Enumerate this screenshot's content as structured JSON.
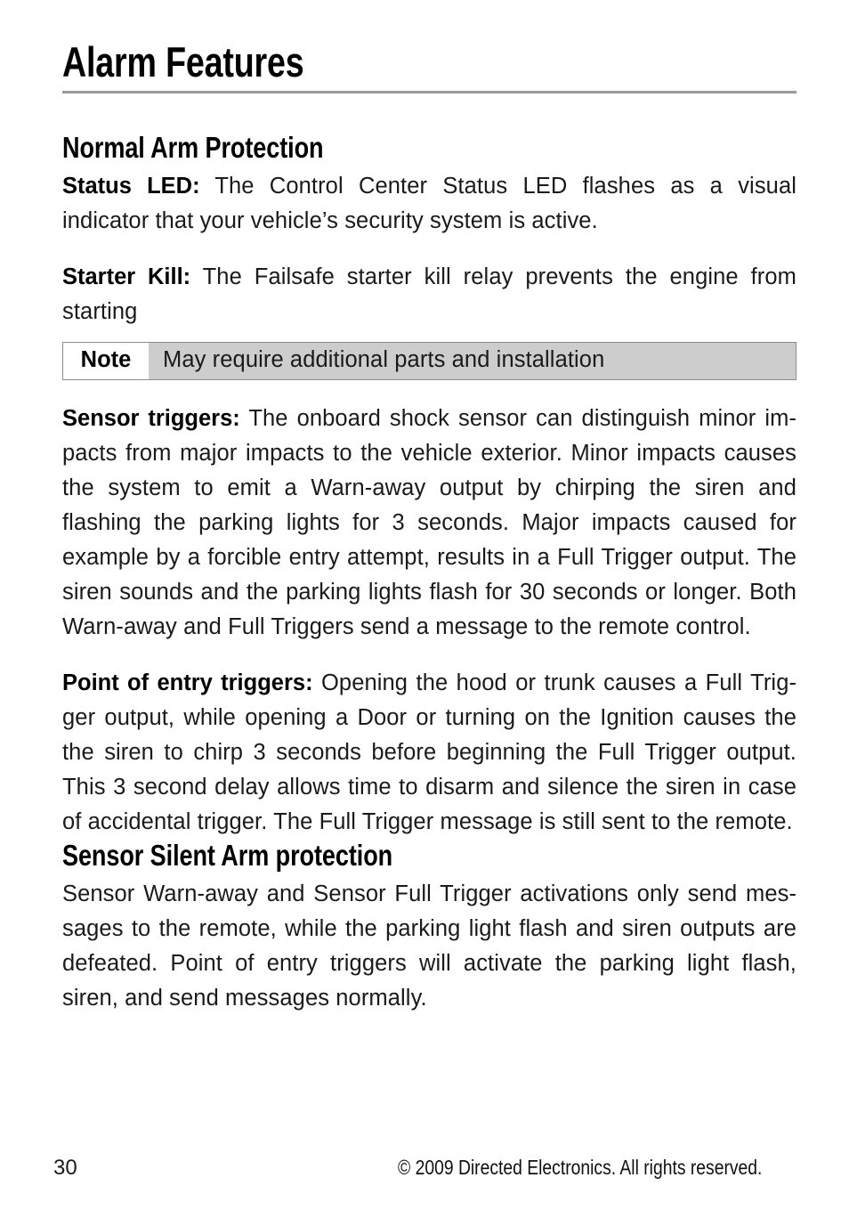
{
  "document": {
    "title": "Alarm Features",
    "page_number": "30",
    "copyright": "© 2009 Directed Electronics. All rights reserved.",
    "accent_rule_color": "#9a9a9a",
    "note_background_color": "#cdcdcd",
    "note_border_color": "#8c8c8c"
  },
  "sections": [
    {
      "heading": "Normal Arm Protection",
      "paragraphs": [
        {
          "lead": "Status LED:",
          "text": " The Control Center Status LED flashes as a visual indicator that your vehicle’s security system is active."
        },
        {
          "lead": "Starter Kill:",
          "text": " The Failsafe starter kill relay prevents the engine from starting"
        }
      ],
      "note": {
        "label": "Note",
        "text": "May require additional parts and installation"
      },
      "paragraphs_after_note": [
        {
          "lead": "Sensor triggers:",
          "text": " The onboard shock sensor can distinguish minor im­pacts from major impacts to the vehicle exterior. Minor impacts causes the system to emit a Warn-away output by chirping the siren and flashing the parking lights for 3 seconds. Major impacts caused for example by a forcible entry attempt, results in a Full Trigger output. The siren sounds and the parking lights flash for 30 seconds or longer. Both Warn-away and Full Triggers send a message to the remote control."
        },
        {
          "lead": "Point of entry triggers:",
          "text": " Opening the hood or trunk causes a Full Trig­ger output, while opening a Door or turning on the Ignition causes the the siren to chirp 3 seconds before beginning the Full Trigger output. This 3 second delay allows time to disarm and silence the siren in case of accidental trigger. The Full Trigger message is still sent to the remote."
        }
      ]
    },
    {
      "heading": "Sensor Silent Arm protection",
      "paragraphs": [
        {
          "lead": "",
          "text": "Sensor Warn-away and Sensor Full Trigger activations only send mes­sages to the remote, while the parking light flash and siren outputs are defeated. Point of entry triggers will activate the parking light flash, siren, and send messages normally."
        }
      ]
    }
  ]
}
